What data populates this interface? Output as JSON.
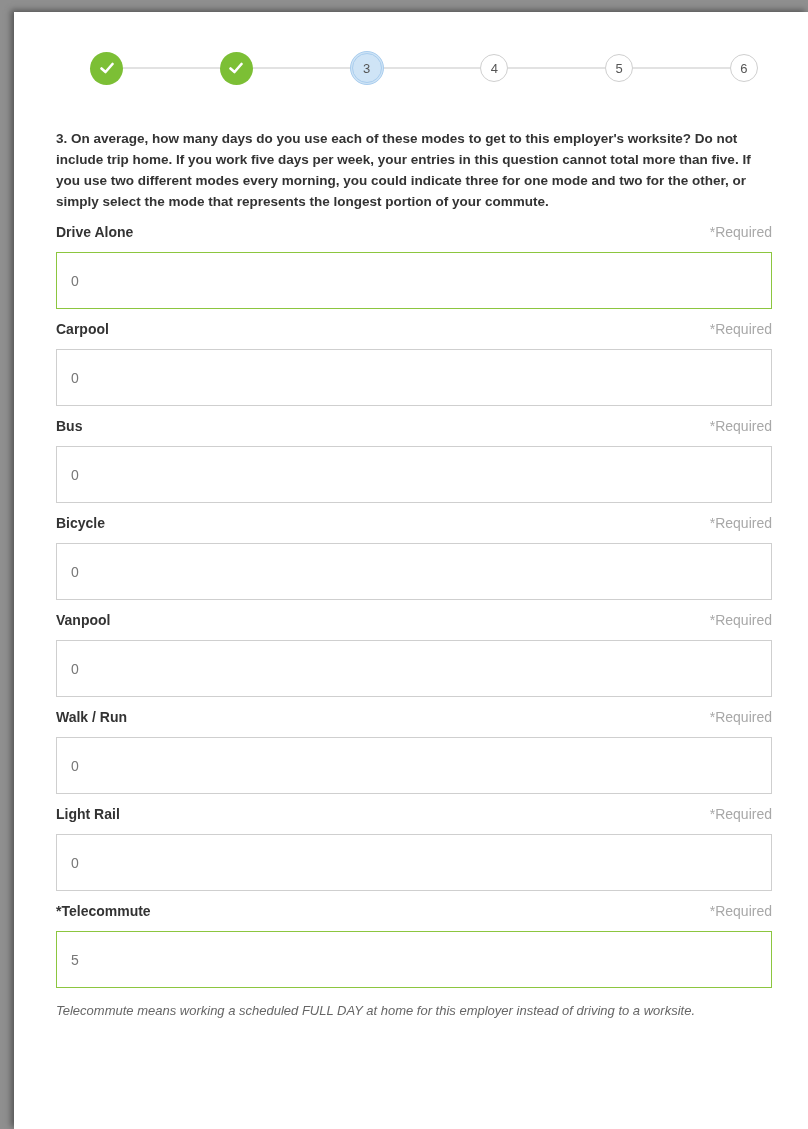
{
  "steps": [
    {
      "kind": "done"
    },
    {
      "kind": "done"
    },
    {
      "label": "3",
      "kind": "current"
    },
    {
      "label": "4",
      "kind": "upcoming"
    },
    {
      "label": "5",
      "kind": "upcoming"
    },
    {
      "label": "6",
      "kind": "upcoming"
    }
  ],
  "question": "3. On average, how many days do you use each of these modes to get to this employer's worksite? Do not include trip home. If you work five days per week, your entries in this question cannot total more than five. If you use two different modes every morning, you could indicate three for one mode and two for the other, or simply select the mode that represents the longest portion of your commute.",
  "fields": [
    {
      "label": "Drive Alone",
      "required_note": "*Required",
      "value": "0",
      "highlighted": true
    },
    {
      "label": "Carpool",
      "required_note": "*Required",
      "value": "0",
      "highlighted": false
    },
    {
      "label": "Bus",
      "required_note": "*Required",
      "value": "0",
      "highlighted": false
    },
    {
      "label": "Bicycle",
      "required_note": "*Required",
      "value": "0",
      "highlighted": false
    },
    {
      "label": "Vanpool",
      "required_note": "*Required",
      "value": "0",
      "highlighted": false
    },
    {
      "label": "Walk / Run",
      "required_note": "*Required",
      "value": "0",
      "highlighted": false
    },
    {
      "label": "Light Rail",
      "required_note": "*Required",
      "value": "0",
      "highlighted": false
    },
    {
      "label": "*Telecommute",
      "required_note": "*Required",
      "value": "5",
      "highlighted": true
    }
  ],
  "note": "Telecommute means working a scheduled FULL DAY at home for this employer instead of driving to a worksite."
}
